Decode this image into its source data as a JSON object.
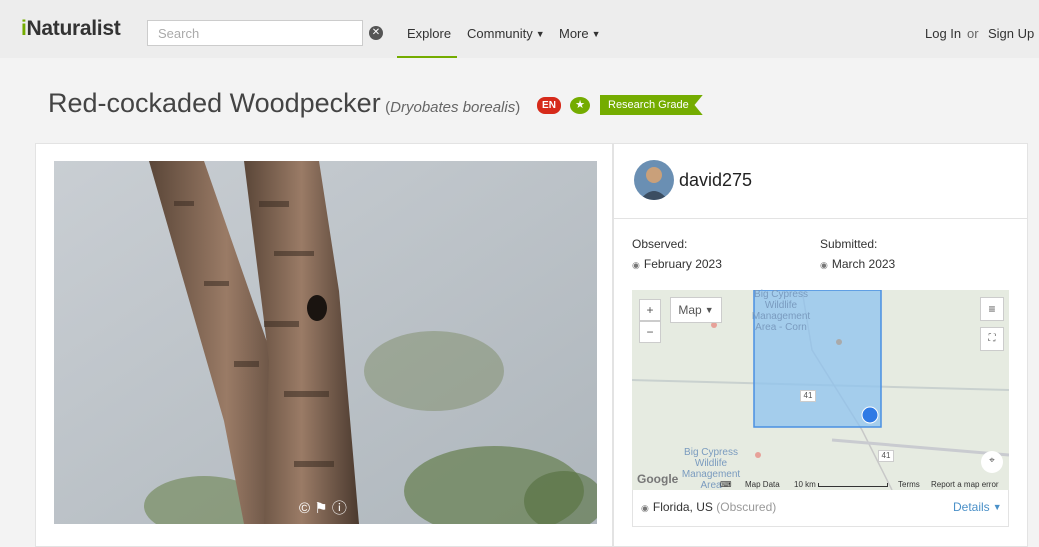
{
  "nav": {
    "logo_prefix": "i",
    "logo_rest": "Naturalist",
    "search_placeholder": "Search",
    "explore": "Explore",
    "community": "Community",
    "more": "More",
    "login": "Log In",
    "or": "or",
    "signup": "Sign Up"
  },
  "title": {
    "common_name": "Red-cockaded Woodpecker",
    "scientific_name": "Dryobates borealis",
    "status_badge": "EN",
    "quality_grade": "Research Grade"
  },
  "observer": {
    "username": "david275"
  },
  "dates": {
    "observed_label": "Observed:",
    "observed_value": "February 2023",
    "submitted_label": "Submitted:",
    "submitted_value": "March 2023"
  },
  "map": {
    "type_button": "Map",
    "zoom_in": "+",
    "zoom_out": "−",
    "label_top": "Big Cypress Wildlife Management Area - Corn",
    "label_bottom": "Big Cypress Wildlife Management Area",
    "road_1": "41",
    "road_2": "41",
    "google": "Google",
    "map_data": "Map Data",
    "scale": "10 km",
    "terms": "Terms",
    "report": "Report a map error"
  },
  "location": {
    "place": "Florida, US",
    "obscured": "(Obscured)",
    "details": "Details"
  },
  "colors": {
    "brand_green": "#74ac00",
    "endangered_red": "#d62a1a",
    "link_blue": "#4a90c8"
  }
}
